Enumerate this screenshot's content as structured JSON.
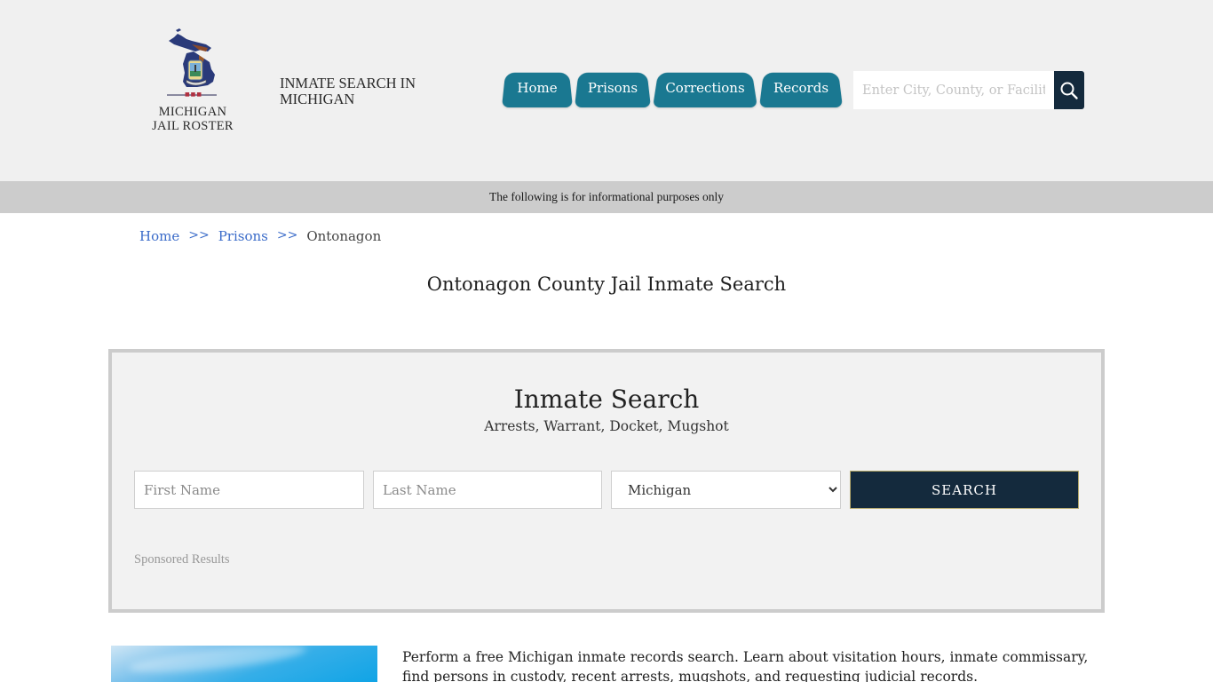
{
  "header": {
    "logo": {
      "line1": "MICHIGAN",
      "line2": "JAIL ROSTER",
      "icon": "michigan-state-map-icon"
    },
    "tagline": "INMATE SEARCH IN MICHIGAN",
    "nav": [
      {
        "label": "Home"
      },
      {
        "label": "Prisons"
      },
      {
        "label": "Corrections"
      },
      {
        "label": "Records"
      }
    ],
    "site_search": {
      "placeholder": "Enter City, County, or Facility",
      "value": "",
      "button_icon": "search-icon"
    },
    "colors": {
      "nav_bg": "#1a7891",
      "search_btn_bg": "#142a3d",
      "header_bg": "#f0f0f0"
    }
  },
  "infobar": {
    "text": "The following is for informational purposes only"
  },
  "breadcrumb": {
    "items": [
      {
        "label": "Home"
      },
      {
        "label": "Prisons"
      }
    ],
    "separator": ">>",
    "current": "Ontonagon"
  },
  "page": {
    "title": "Ontonagon County Jail Inmate Search"
  },
  "search_panel": {
    "title": "Inmate Search",
    "subtitle": "Arrests, Warrant, Docket, Mugshot",
    "first_name": {
      "placeholder": "First Name",
      "value": ""
    },
    "last_name": {
      "placeholder": "Last Name",
      "value": ""
    },
    "state": {
      "selected": "Michigan"
    },
    "button_label": "SEARCH",
    "sponsored_label": "Sponsored Results"
  },
  "intro": {
    "text": "Perform a free Michigan inmate records search. Learn about visitation hours, inmate commissary, find persons in custody, recent arrests, mugshots, and requesting judicial records."
  }
}
